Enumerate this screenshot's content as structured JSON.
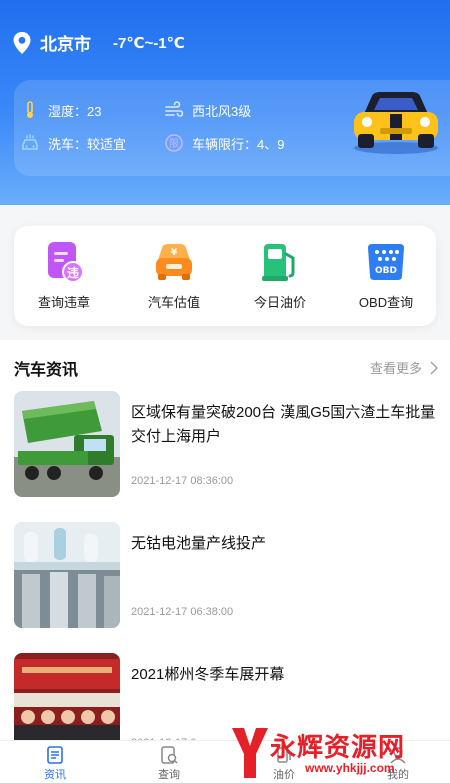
{
  "location": {
    "city": "北京市",
    "temperature": "-7℃~-1℃",
    "icon": "location-pin-icon"
  },
  "weather": {
    "humidity": "湿度：23",
    "wind": "西北风3级",
    "car_wash": "洗车：较适宜",
    "restriction": "车辆限行：4、9"
  },
  "quick_actions": [
    {
      "label": "查询违章",
      "icon": "violation-query-icon",
      "badge": "违"
    },
    {
      "label": "汽车估值",
      "icon": "car-valuation-icon",
      "badge": "¥"
    },
    {
      "label": "今日油价",
      "icon": "fuel-pump-icon"
    },
    {
      "label": "OBD查询",
      "icon": "obd-device-icon",
      "badge": "OBD"
    }
  ],
  "news": {
    "title": "汽车资讯",
    "more": "查看更多",
    "items": [
      {
        "title": "区域保有量突破200台 漢風G5国六渣土车批量交付上海用户",
        "time": "2021-12-17 08:36:00"
      },
      {
        "title": "无钴电池量产线投产",
        "time": "2021-12-17 06:38:00"
      },
      {
        "title": "2021郴州冬季车展开幕",
        "time": "2021-12-17 0"
      }
    ]
  },
  "tabs": [
    {
      "label": "资讯",
      "icon": "news-icon",
      "active": true
    },
    {
      "label": "查询",
      "icon": "query-icon",
      "active": false
    },
    {
      "label": "油价",
      "icon": "fuel-price-icon",
      "active": false
    },
    {
      "label": "我的",
      "icon": "profile-icon",
      "active": false
    }
  ],
  "watermark": {
    "brand": "永辉资源网",
    "url": "www.yhkjjj.com"
  },
  "colors": {
    "primary": "#2a72ee",
    "header_top": "#1f6ff0",
    "watermark": "#e62029"
  }
}
